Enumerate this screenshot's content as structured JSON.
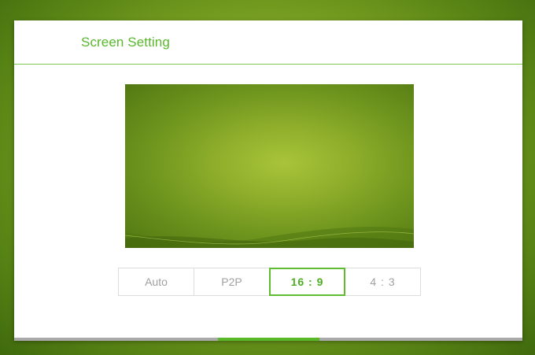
{
  "dialog": {
    "title": "Screen Setting"
  },
  "preview": {
    "description_icon": "wallpaper-preview"
  },
  "ratio_options": [
    {
      "label": "Auto",
      "selected": false
    },
    {
      "label": "P2P",
      "selected": false
    },
    {
      "label": "16 : 9",
      "selected": true
    },
    {
      "label": "4 : 3",
      "selected": false
    }
  ],
  "scroll": {
    "position_fraction": 0.4,
    "thumb_fraction": 0.2
  },
  "colors": {
    "accent": "#58b82a",
    "divider": "#7cc94e",
    "inactive_text": "#a0a0a0",
    "background_green": "#8cb02a"
  }
}
